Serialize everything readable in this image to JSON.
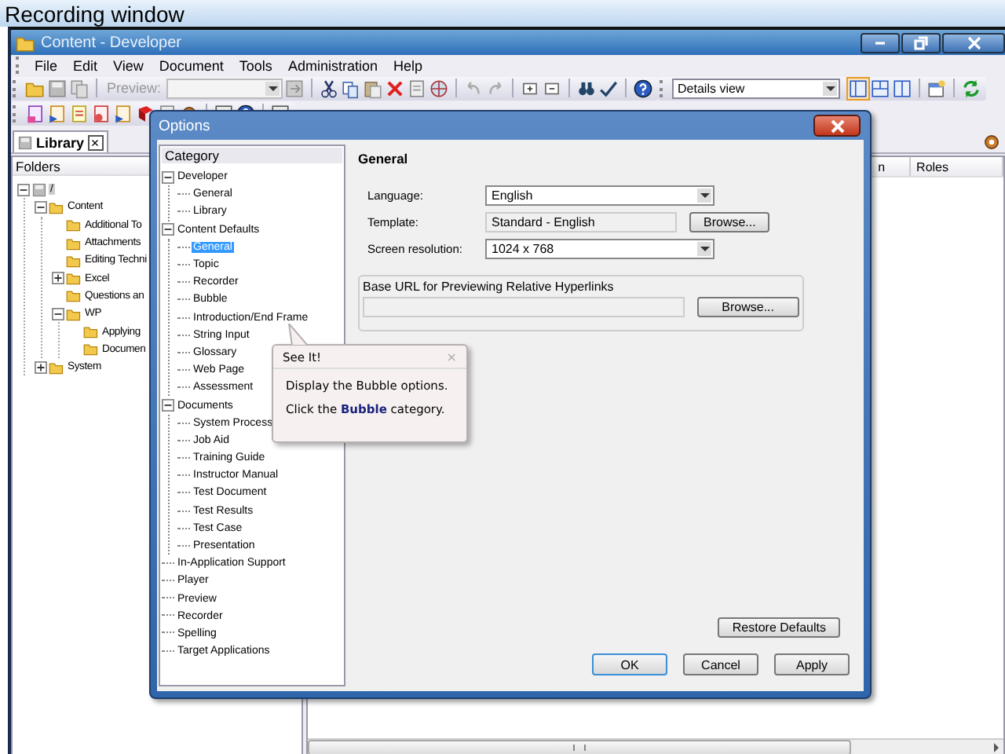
{
  "recording_window": {
    "title": "Recording window"
  },
  "window": {
    "title": "Content - Developer"
  },
  "menu": [
    "File",
    "Edit",
    "View",
    "Document",
    "Tools",
    "Administration",
    "Help"
  ],
  "toolbar": {
    "preview_label": "Preview:",
    "view_select": "Details view"
  },
  "library_tab": {
    "label": "Library",
    "close": "×"
  },
  "folders": {
    "header": "Folders",
    "tree": [
      {
        "label": "/",
        "expanded": true,
        "selected": true,
        "children": [
          {
            "label": "Content",
            "expanded": true,
            "selected": false,
            "children": [
              {
                "label": "Additional To",
                "selected": false
              },
              {
                "label": "Attachments",
                "selected": false
              },
              {
                "label": "Editing Techni",
                "selected": false
              },
              {
                "label": "Excel",
                "expanded": false,
                "selected": false
              },
              {
                "label": "Questions an",
                "selected": false
              },
              {
                "label": "WP",
                "expanded": true,
                "selected": false,
                "children": [
                  {
                    "label": "Applying",
                    "selected": false
                  },
                  {
                    "label": "Documen",
                    "selected": false
                  }
                ]
              }
            ]
          },
          {
            "label": "System",
            "expanded": false,
            "selected": false
          }
        ]
      }
    ]
  },
  "list": {
    "columns": [
      "n",
      "Roles"
    ]
  },
  "dialog": {
    "title": "Options",
    "category_header": "Category",
    "categories": [
      {
        "label": "Developer",
        "expanded": true,
        "selected": false,
        "children": [
          {
            "label": "General",
            "selected": false
          },
          {
            "label": "Library",
            "selected": false
          }
        ]
      },
      {
        "label": "Content Defaults",
        "expanded": true,
        "selected": false,
        "children": [
          {
            "label": "General",
            "selected": true
          },
          {
            "label": "Topic",
            "selected": false
          },
          {
            "label": "Recorder",
            "selected": false
          },
          {
            "label": "Bubble",
            "selected": false
          },
          {
            "label": "Introduction/End Frame",
            "selected": false
          },
          {
            "label": "String Input",
            "selected": false
          },
          {
            "label": "Glossary",
            "selected": false
          },
          {
            "label": "Web Page",
            "selected": false
          },
          {
            "label": "Assessment",
            "selected": false
          }
        ]
      },
      {
        "label": "Documents",
        "expanded": true,
        "selected": false,
        "children": [
          {
            "label": "System Process",
            "selected": false
          },
          {
            "label": "Job Aid",
            "selected": false
          },
          {
            "label": "Training Guide",
            "selected": false
          },
          {
            "label": "Instructor Manual",
            "selected": false
          },
          {
            "label": "Test Document",
            "selected": false
          },
          {
            "label": "Test Results",
            "selected": false
          },
          {
            "label": "Test Case",
            "selected": false
          },
          {
            "label": "Presentation",
            "selected": false
          }
        ]
      },
      {
        "label": "In-Application Support",
        "selected": false
      },
      {
        "label": "Player",
        "selected": false
      },
      {
        "label": "Preview",
        "selected": false
      },
      {
        "label": "Recorder",
        "selected": false
      },
      {
        "label": "Spelling",
        "selected": false
      },
      {
        "label": "Target Applications",
        "selected": false
      }
    ],
    "section_title": "General",
    "fields": [
      {
        "label": "Language:",
        "kind": "dropdown",
        "value": "English"
      },
      {
        "label": "Template:",
        "kind": "readonly",
        "value": "Standard - English",
        "button": "Browse..."
      },
      {
        "label": "Screen resolution:",
        "kind": "dropdown",
        "value": "1024 x 768"
      }
    ],
    "base_url": {
      "legend": "Base URL for Previewing Relative Hyperlinks",
      "button": "Browse..."
    },
    "restore_button": "Restore Defaults",
    "buttons": [
      {
        "label": "OK",
        "default": true
      },
      {
        "label": "Cancel",
        "default": false
      },
      {
        "label": "Apply",
        "default": false
      }
    ]
  },
  "tooltip": {
    "title": "See It!",
    "close": "×",
    "lines": [
      "Display the Bubble options.",
      "Click the **Bubble** category."
    ]
  }
}
